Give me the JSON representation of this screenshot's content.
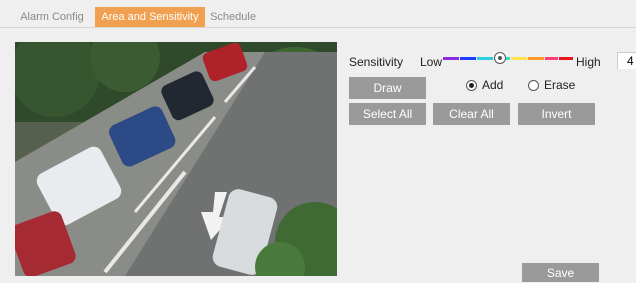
{
  "tabs": [
    {
      "label": "Alarm Config"
    },
    {
      "label": "Area and Sensitivity"
    },
    {
      "label": "Schedule"
    }
  ],
  "sensitivity": {
    "label": "Sensitivity",
    "low_label": "Low",
    "high_label": "High",
    "value": "4",
    "level_fraction": 0.45,
    "scale_colors": [
      "#8a2be2",
      "#1e3cff",
      "#29d0e0",
      "#2de0c8",
      "#ffe14a",
      "#ff9a2a",
      "#ff3d7a",
      "#e8141e"
    ]
  },
  "buttons": {
    "draw": "Draw",
    "select_all": "Select All",
    "clear_all": "Clear All",
    "invert": "Invert",
    "save": "Save"
  },
  "mode": {
    "add_label": "Add",
    "erase_label": "Erase",
    "selected": "Add"
  },
  "colors": {
    "active_tab": "#f0a050",
    "button": "#9a9a9a"
  }
}
